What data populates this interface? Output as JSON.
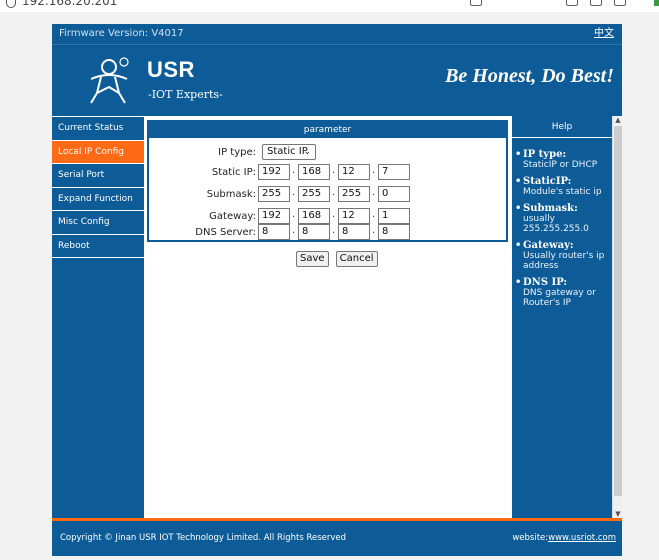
{
  "browser": {
    "url": "192.168.20.201"
  },
  "firmware": {
    "label": "Firmware Version: V4017",
    "lang": "中文"
  },
  "brand": {
    "name": "USR",
    "tagline": "-IOT Experts-",
    "slogan": "Be Honest, Do Best!"
  },
  "nav": {
    "items": [
      {
        "label": "Current Status"
      },
      {
        "label": "Local IP Config"
      },
      {
        "label": "Serial Port"
      },
      {
        "label": "Expand Function"
      },
      {
        "label": "Misc Config"
      },
      {
        "label": "Reboot"
      }
    ],
    "active_index": 1
  },
  "panel": {
    "title": "parameter",
    "ip_type": {
      "label": "IP type:",
      "value": "Static IP"
    },
    "rows": [
      {
        "label": "Static IP:",
        "octets": [
          "192",
          "168",
          "12",
          "7"
        ]
      },
      {
        "label": "Submask:",
        "octets": [
          "255",
          "255",
          "255",
          "0"
        ]
      },
      {
        "label": "Gateway:",
        "octets": [
          "192",
          "168",
          "12",
          "1"
        ]
      },
      {
        "label": "DNS Server:",
        "octets": [
          "8",
          "8",
          "8",
          "8"
        ]
      }
    ],
    "save_label": "Save",
    "cancel_label": "Cancel"
  },
  "help": {
    "title": "Help",
    "items": [
      {
        "title": "IP type:",
        "desc": "StaticIP or DHCP"
      },
      {
        "title": "StaticIP:",
        "desc": "Module's static ip"
      },
      {
        "title": "Submask:",
        "desc": "usually 255.255.255.0"
      },
      {
        "title": "Gateway:",
        "desc": "Usually router's ip address"
      },
      {
        "title": "DNS IP:",
        "desc": "DNS gateway or Router's IP"
      }
    ]
  },
  "footer": {
    "copyright": "Copyright © Jinan USR IOT Technology Limited. All Rights Reserved",
    "website_label": "website:",
    "website_link": "www.usriot.com"
  },
  "colors": {
    "primary": "#0d5c98",
    "accent": "#ff6a14"
  }
}
